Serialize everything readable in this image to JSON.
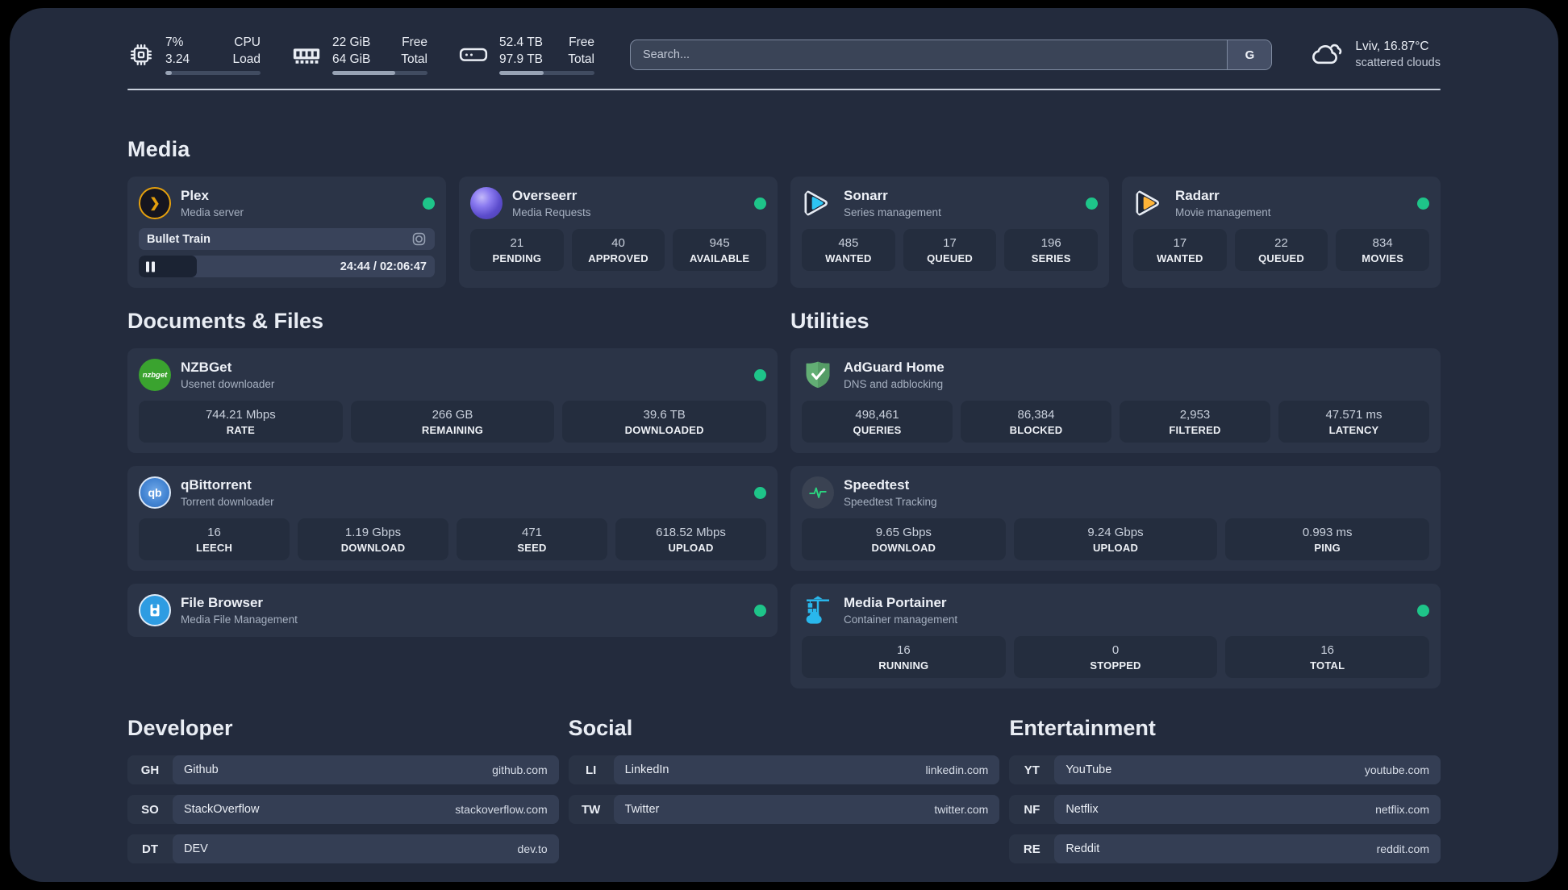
{
  "colors": {
    "status_online": "#1ec489",
    "page_background": "#232b3d",
    "card_background": "#2b3447"
  },
  "topbar": {
    "stats": [
      {
        "icon": "cpu-icon",
        "values": [
          "7%",
          "3.24"
        ],
        "labels": [
          "CPU",
          "Load"
        ],
        "progress": 7
      },
      {
        "icon": "ram-icon",
        "values": [
          "22 GiB",
          "64 GiB"
        ],
        "labels": [
          "Free",
          "Total"
        ],
        "progress": 66
      },
      {
        "icon": "disk-icon",
        "values": [
          "52.4 TB",
          "97.9 TB"
        ],
        "labels": [
          "Free",
          "Total"
        ],
        "progress": 47
      }
    ],
    "search": {
      "placeholder": "Search...",
      "button": "G"
    },
    "weather": {
      "icon": "cloud-icon",
      "location": "Lviv, 16.87°C",
      "condition": "scattered clouds"
    }
  },
  "sections": {
    "media": {
      "title": "Media",
      "cards": [
        {
          "icon": "plex-icon",
          "name": "Plex",
          "desc": "Media server",
          "status": "online",
          "media": {
            "title": "Bullet Train",
            "time": "24:44 / 02:06:47",
            "progress_pct": 19.6,
            "state": "paused"
          }
        },
        {
          "icon": "overseerr-icon",
          "name": "Overseerr",
          "desc": "Media Requests",
          "status": "online",
          "stats": [
            {
              "value": "21",
              "label": "PENDING"
            },
            {
              "value": "40",
              "label": "APPROVED"
            },
            {
              "value": "945",
              "label": "AVAILABLE"
            }
          ]
        },
        {
          "icon": "sonarr-icon",
          "name": "Sonarr",
          "desc": "Series management",
          "status": "online",
          "stats": [
            {
              "value": "485",
              "label": "WANTED"
            },
            {
              "value": "17",
              "label": "QUEUED"
            },
            {
              "value": "196",
              "label": "SERIES"
            }
          ]
        },
        {
          "icon": "radarr-icon",
          "name": "Radarr",
          "desc": "Movie management",
          "status": "online",
          "stats": [
            {
              "value": "17",
              "label": "WANTED"
            },
            {
              "value": "22",
              "label": "QUEUED"
            },
            {
              "value": "834",
              "label": "MOVIES"
            }
          ]
        }
      ]
    },
    "documents": {
      "title": "Documents & Files",
      "cards": [
        {
          "icon": "nzbget-icon",
          "name": "NZBGet",
          "desc": "Usenet downloader",
          "status": "online",
          "icon_text": "nzbget",
          "stats": [
            {
              "value": "744.21 Mbps",
              "label": "RATE"
            },
            {
              "value": "266 GB",
              "label": "REMAINING"
            },
            {
              "value": "39.6 TB",
              "label": "DOWNLOADED"
            }
          ]
        },
        {
          "icon": "qbittorrent-icon",
          "name": "qBittorrent",
          "desc": "Torrent downloader",
          "status": "online",
          "icon_text": "qb",
          "stats": [
            {
              "value": "16",
              "label": "LEECH"
            },
            {
              "value": "1.19 Gbps",
              "label": "DOWNLOAD"
            },
            {
              "value": "471",
              "label": "SEED"
            },
            {
              "value": "618.52 Mbps",
              "label": "UPLOAD"
            }
          ]
        },
        {
          "icon": "filebrowser-icon",
          "name": "File Browser",
          "desc": "Media File Management",
          "status": "online",
          "stats": []
        }
      ]
    },
    "utilities": {
      "title": "Utilities",
      "cards": [
        {
          "icon": "adguard-icon",
          "name": "AdGuard Home",
          "desc": "DNS and adblocking",
          "stats": [
            {
              "value": "498,461",
              "label": "QUERIES"
            },
            {
              "value": "86,384",
              "label": "BLOCKED"
            },
            {
              "value": "2,953",
              "label": "FILTERED"
            },
            {
              "value": "47.571 ms",
              "label": "LATENCY"
            }
          ]
        },
        {
          "icon": "speedtest-icon",
          "name": "Speedtest",
          "desc": "Speedtest Tracking",
          "stats": [
            {
              "value": "9.65 Gbps",
              "label": "DOWNLOAD"
            },
            {
              "value": "9.24 Gbps",
              "label": "UPLOAD"
            },
            {
              "value": "0.993 ms",
              "label": "PING"
            }
          ]
        },
        {
          "icon": "portainer-icon",
          "name": "Media Portainer",
          "desc": "Container management",
          "status": "online",
          "stats": [
            {
              "value": "16",
              "label": "RUNNING"
            },
            {
              "value": "0",
              "label": "STOPPED"
            },
            {
              "value": "16",
              "label": "TOTAL"
            }
          ]
        }
      ]
    },
    "bookmarks": {
      "groups": [
        {
          "title": "Developer",
          "items": [
            {
              "abbr": "GH",
              "name": "Github",
              "url": "github.com"
            },
            {
              "abbr": "SO",
              "name": "StackOverflow",
              "url": "stackoverflow.com"
            },
            {
              "abbr": "DT",
              "name": "DEV",
              "url": "dev.to"
            }
          ]
        },
        {
          "title": "Social",
          "items": [
            {
              "abbr": "LI",
              "name": "LinkedIn",
              "url": "linkedin.com"
            },
            {
              "abbr": "TW",
              "name": "Twitter",
              "url": "twitter.com"
            }
          ]
        },
        {
          "title": "Entertainment",
          "items": [
            {
              "abbr": "YT",
              "name": "YouTube",
              "url": "youtube.com"
            },
            {
              "abbr": "NF",
              "name": "Netflix",
              "url": "netflix.com"
            },
            {
              "abbr": "RE",
              "name": "Reddit",
              "url": "reddit.com"
            }
          ]
        }
      ]
    }
  }
}
